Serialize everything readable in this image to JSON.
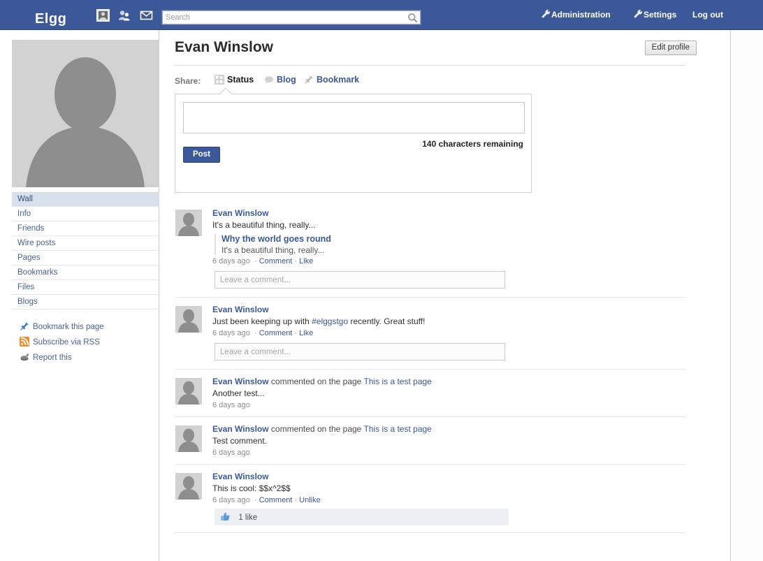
{
  "header": {
    "brand": "Elgg",
    "icons": [
      {
        "name": "profile-icon",
        "label": "Profile"
      },
      {
        "name": "friends-icon",
        "label": "Friends"
      },
      {
        "name": "messages-icon",
        "label": "Messages"
      }
    ],
    "search": {
      "value": "",
      "placeholder": "Search"
    },
    "links": {
      "administration": "Administration",
      "settings": "Settings",
      "logout": "Log out"
    },
    "bg_color": "#3b5998"
  },
  "profile": {
    "title": "Evan Winslow",
    "edit_button": "Edit profile"
  },
  "sidebar": {
    "nav": [
      {
        "label": "Wall",
        "active": true
      },
      {
        "label": "Info",
        "active": false
      },
      {
        "label": "Friends",
        "active": false
      },
      {
        "label": "Wire posts",
        "active": false
      },
      {
        "label": "Pages",
        "active": false
      },
      {
        "label": "Bookmarks",
        "active": false
      },
      {
        "label": "Files",
        "active": false
      },
      {
        "label": "Blogs",
        "active": false
      }
    ],
    "tools": [
      {
        "label": "Bookmark this page",
        "icon": "pushpin-icon"
      },
      {
        "label": "Subscribe via RSS",
        "icon": "rss-icon"
      },
      {
        "label": "Report this",
        "icon": "report-icon"
      }
    ]
  },
  "share": {
    "label": "Share:",
    "tabs": [
      {
        "label": "Status",
        "icon": "status-icon",
        "active": true
      },
      {
        "label": "Blog",
        "icon": "blog-bubble-icon",
        "active": false
      },
      {
        "label": "Bookmark",
        "icon": "pushpin-icon",
        "active": false
      }
    ]
  },
  "composer": {
    "value": "",
    "placeholder": "",
    "char_count": "140 characters remaining",
    "post_button": "Post"
  },
  "feed": [
    {
      "author": "Evan Winslow",
      "verb": "",
      "target": "",
      "text": "It's a beautiful thing, really...",
      "quote_title": "Why the world goes round",
      "quote_text": "It's a beautiful thing, really...",
      "time": "6 days ago",
      "actions": [
        "Comment",
        "Like"
      ],
      "comment_placeholder": "Leave a comment...",
      "likes": ""
    },
    {
      "author": "Evan Winslow",
      "verb": "",
      "target": "",
      "text_pre": "Just been keeping up with ",
      "hashtag": "#elggstgo",
      "text_post": " recently. Great stuff!",
      "time": "6 days ago",
      "actions": [
        "Comment",
        "Like"
      ],
      "comment_placeholder": "Leave a comment...",
      "likes": ""
    },
    {
      "author": "Evan Winslow",
      "verb": " commented on the page ",
      "target": "This is a test page",
      "text": "Another test...",
      "time": "6 days ago",
      "actions": [],
      "likes": ""
    },
    {
      "author": "Evan Winslow",
      "verb": " commented on the page ",
      "target": "This is a test page",
      "text": "Test comment.",
      "time": "6 days ago",
      "actions": [],
      "likes": ""
    },
    {
      "author": "Evan Winslow",
      "verb": "",
      "target": "",
      "text": "This is cool: $$x^2$$",
      "time": "6 days ago",
      "actions": [
        "Comment",
        "Unlike"
      ],
      "likes": "1 like"
    }
  ],
  "colors": {
    "brand_blue": "#3b5998",
    "link_blue": "#3b5998",
    "active_nav_bg": "#d8e0ee",
    "rss_orange": "#f08a24"
  }
}
